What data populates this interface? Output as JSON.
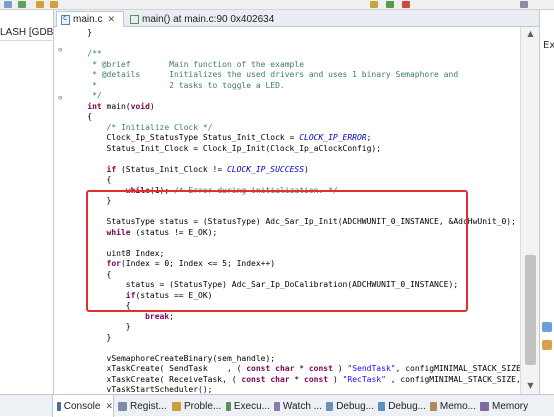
{
  "toolbar": {
    "icons": [
      "debug-icon",
      "run-icon",
      "back-icon",
      "forward-icon",
      "step-icon",
      "resume-icon",
      "stop-icon",
      "search-icon"
    ]
  },
  "debug_view": {
    "label": "LASH [GDB SE"
  },
  "right_panel": {
    "label": "Ex"
  },
  "editor_tabs": [
    {
      "label": "main.c",
      "close": "✕"
    },
    {
      "label": "main() at main.c:90 0x402634"
    }
  ],
  "code_lines": [
    "    }",
    "",
    "    /**",
    "     * @brief        Main function of the example",
    "     * @details      Initializes the used drivers and uses 1 binary Semaphore and",
    "     *               2 tasks to toggle a LED.",
    "     */",
    "    int main(void)",
    "    {",
    "        /* Initialize Clock */",
    "        Clock_Ip_StatusType Status_Init_Clock = CLOCK_IP_ERROR;",
    "        Status_Init_Clock = Clock_Ip_Init(Clock_Ip_aClockConfig);",
    "",
    "        if (Status_Init_Clock != CLOCK_IP_SUCCESS)",
    "        {",
    "            while(1); /* Error during initialization. */",
    "        }",
    "",
    "        StatusType status = (StatusType) Adc_Sar_Ip_Init(ADCHWUNIT_0_INSTANCE, &AdcHwUnit_0);",
    "        while (status != E_OK);",
    "",
    "        uint8 Index;",
    "        for(Index = 0; Index <= 5; Index++)",
    "        {",
    "            status = (StatusType) Adc_Sar_Ip_DoCalibration(ADCHWUNIT_0_INSTANCE);",
    "            if(status == E_OK)",
    "            {",
    "                break;",
    "            }",
    "        }",
    "",
    "        vSemaphoreCreateBinary(sem_handle);",
    "        xTaskCreate( SendTask    , ( const char * const ) \"SendTask\", configMINIMAL_STACK_SIZE, (void*)0, m",
    "        xTaskCreate( ReceiveTask, ( const char * const ) \"RecTask\" , configMINIMAL_STACK_SIZE, (void*)0, m",
    "        vTaskStartScheduler();",
    "",
    "        for( ;; );"
  ],
  "highlight_color": "#e03030",
  "bottom_tabs": [
    {
      "label": "Console",
      "icon": "console-icon",
      "close": "✕"
    },
    {
      "label": "Regist...",
      "icon": "registers-icon"
    },
    {
      "label": "Proble...",
      "icon": "problems-icon"
    },
    {
      "label": "Execu...",
      "icon": "executables-icon"
    },
    {
      "label": "Watch ...",
      "icon": "watch-icon"
    },
    {
      "label": "Debug...",
      "icon": "debugger-console-icon"
    },
    {
      "label": "Debug...",
      "icon": "debug-icon"
    },
    {
      "label": "Memo...",
      "icon": "memory-icon"
    },
    {
      "label": "Memory",
      "icon": "memory-view-icon"
    }
  ]
}
